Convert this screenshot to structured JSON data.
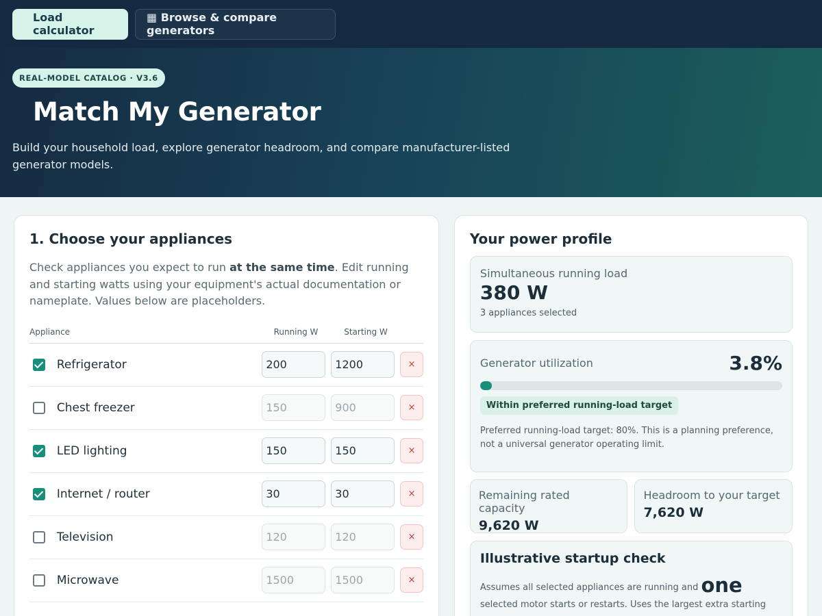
{
  "nav": {
    "tabs": [
      {
        "label": "Load calculator",
        "active": true
      },
      {
        "label": "▦ Browse & compare generators",
        "active": false
      }
    ]
  },
  "hero": {
    "badge": "REAL-MODEL CATALOG · V3.6",
    "title": "Match My Generator",
    "subtitle": "Build your household load, explore generator headroom, and compare manufacturer-listed generator models."
  },
  "appliances": {
    "heading": "1. Choose your appliances",
    "intro_before": "Check appliances you expect to run ",
    "intro_bold": "at the same time",
    "intro_after": ". Edit running and starting watts using your equipment's actual documentation or nameplate. Values below are placeholders.",
    "columns": {
      "appliance": "Appliance",
      "running": "Running W",
      "starting": "Starting W"
    },
    "remove_symbol": "×",
    "rows": [
      {
        "name": "Refrigerator",
        "checked": true,
        "running": "200",
        "starting": "1200"
      },
      {
        "name": "Chest freezer",
        "checked": false,
        "running": "150",
        "starting": "900"
      },
      {
        "name": "LED lighting",
        "checked": true,
        "running": "150",
        "starting": "150"
      },
      {
        "name": "Internet / router",
        "checked": true,
        "running": "30",
        "starting": "30"
      },
      {
        "name": "Television",
        "checked": false,
        "running": "120",
        "starting": "120"
      },
      {
        "name": "Microwave",
        "checked": false,
        "running": "1500",
        "starting": "1500"
      }
    ]
  },
  "profile": {
    "heading": "Your power profile",
    "load_label": "Simultaneous running load",
    "load_value": "380 W",
    "load_sub": "3 appliances selected",
    "util_label": "Generator utilization",
    "util_value": "3.8%",
    "util_fraction": 0.038,
    "util_status": "Within preferred running-load target",
    "util_note": "Preferred running-load target: 80%. This is a planning preference, not a universal generator operating limit.",
    "remaining_label": "Remaining rated capacity",
    "remaining_value": "9,620 W",
    "headroom_label": "Headroom to your target",
    "headroom_value": "7,620 W",
    "startup_title": "Illustrative startup check",
    "startup_before": "Assumes all selected appliances are running and ",
    "startup_em": "one",
    "startup_after": " selected motor starts or restarts. Uses the largest extra starting demand; real"
  },
  "colors": {
    "accent": "#178f7c",
    "nav_bg": "#152a40",
    "active_tab": "#d6f3ea"
  }
}
